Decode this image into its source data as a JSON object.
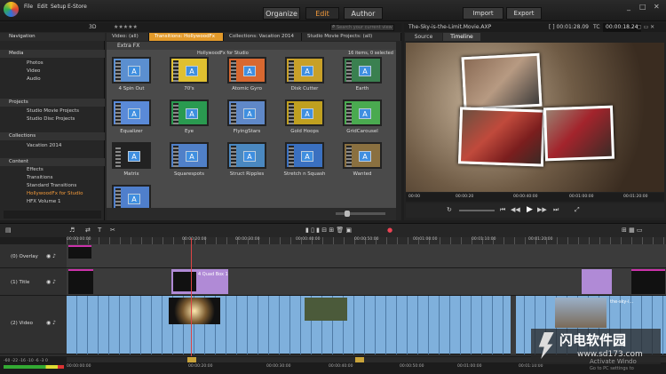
{
  "menu": [
    "File",
    "Edit",
    "Setup",
    "E-Store"
  ],
  "modes": {
    "organize": "Organize",
    "edit": "Edit",
    "author": "Author"
  },
  "actions": {
    "import": "Import",
    "export": "Export"
  },
  "library": {
    "toolbar_label": "3D",
    "stars": "★★★★★",
    "search_placeholder": "Search your current view",
    "tabs": [
      "Video: (all)",
      "Transitions: HollywoodFx",
      "Collections: Vacation 2014",
      "Studio Movie Projects: (all)"
    ],
    "group": "Extra FX",
    "group_sub": "HollywoodFx for Studio",
    "count": "16 items, 0 selected",
    "items": [
      "4 Spin Out",
      "70's",
      "Atomic Gyro",
      "Disk Cutter",
      "Earth",
      "Equalizer",
      "Eye",
      "FlyingStars",
      "Gold Hoops",
      "GridCarousel",
      "Matrix",
      "Squarespots",
      "Struct Ripples",
      "Stretch n Squash",
      "Wanted",
      ""
    ]
  },
  "nav": {
    "title": "Navigation",
    "sections": [
      {
        "label": "Media",
        "children": [
          "Photos",
          "Video",
          "Audio"
        ]
      },
      {
        "label": "Projects",
        "children": [
          "Studio Movie Projects",
          "Studio Disc Projects"
        ]
      },
      {
        "label": "Collections",
        "children": [
          "Vacation 2014"
        ]
      },
      {
        "label": "Content",
        "children": [
          "Effects",
          "Transitions",
          "Standard Transitions",
          "HollywoodFx for Studio",
          "HFX Volume 1"
        ]
      }
    ]
  },
  "player": {
    "title": "The-Sky-is-the-Limit.Movie.AXP",
    "timecode_left": "[ ] 00:01:28.09",
    "timecode_label": "TC",
    "timecode": "00:00:18.24",
    "tabs": [
      "Source",
      "Timeline"
    ],
    "ruler": [
      "00:00",
      "00:00:20",
      "00:00:40:00",
      "00:01:00:00",
      "00:01:20:00"
    ]
  },
  "timeline": {
    "tracks": [
      "(0) Overlay",
      "(1) Title",
      "(2) Video"
    ],
    "ruler": [
      "00:00:00:00",
      "00:00:20:00",
      "00:00:30:00",
      "00:00:40:00",
      "00:00:50:00",
      "00:01:00:00",
      "00:01:10:00",
      "00:01:20:00"
    ],
    "footer_ruler": [
      "00:00:00:00",
      "00:00:20:00",
      "00:00:30:00",
      "00:00:40:00",
      "00:00:50:00",
      "00:01:00:00",
      "00:01:10:00"
    ],
    "meter": "-60 -22 -16 -10 -6 -3 0",
    "clip_title": "4 Quad Box 1",
    "clip_video_end": "the-sky-i..."
  },
  "watermark": {
    "main": "闪电软件园",
    "sub": "www.sd173.com",
    "activate": "Activate Windo",
    "activate_sub": "Go to PC settings to"
  },
  "colors": {
    "accent": "#f39a3a",
    "clip": "#7fb0dc",
    "title_clip": "#b08ad6"
  }
}
